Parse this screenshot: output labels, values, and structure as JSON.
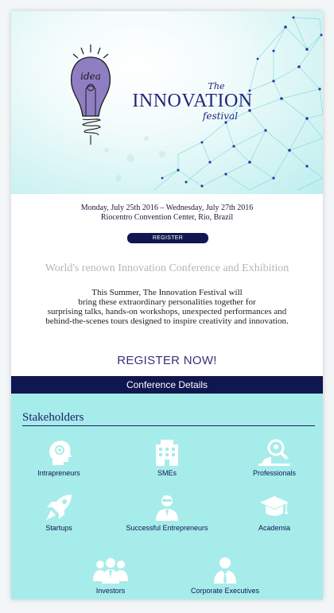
{
  "hero": {
    "logo_the": "The",
    "logo_innovation": "INNOVATION",
    "logo_festival": "festival",
    "bulb_text": "idea"
  },
  "event": {
    "dates_line": "Monday, July 25th 2016 – Wednesday, July 27th 2016",
    "venue_line": "Riocentro Convention Center, Rio, Brazil"
  },
  "register_small_label": "REGISTER",
  "tagline": "World's renown Innovation Conference and Exhibition",
  "intro_lines": [
    "This Summer, The Innovation Festival will",
    "bring these extraordinary personalities together for",
    "surprising talks, hands-on workshops, unexpected performances and",
    "behind-the-scenes tours designed to inspire creativity and innovation."
  ],
  "register_now_label": "REGISTER NOW!",
  "conference_details_label": "Conference Details",
  "stakeholders": {
    "title": "Stakeholders",
    "items": [
      {
        "label": "Intrapreneurs",
        "icon": "head-gear-icon"
      },
      {
        "label": "SMEs",
        "icon": "building-icon"
      },
      {
        "label": "Professionals",
        "icon": "magnifier-person-icon"
      },
      {
        "label": "Startups",
        "icon": "rocket-icon"
      },
      {
        "label": "Successful Entrepreneurs",
        "icon": "businessman-icon"
      },
      {
        "label": "Academia",
        "icon": "graduation-cap-icon"
      },
      {
        "label": "Investors",
        "icon": "group-icon"
      },
      {
        "label": "Corporate Executives",
        "icon": "executive-icon"
      }
    ]
  },
  "colors": {
    "navy": "#10164f",
    "teal_bg": "#a6ecea",
    "purple_text": "#3e2d7a",
    "network_line": "#6fd3d0",
    "network_node": "#2a34a0"
  }
}
